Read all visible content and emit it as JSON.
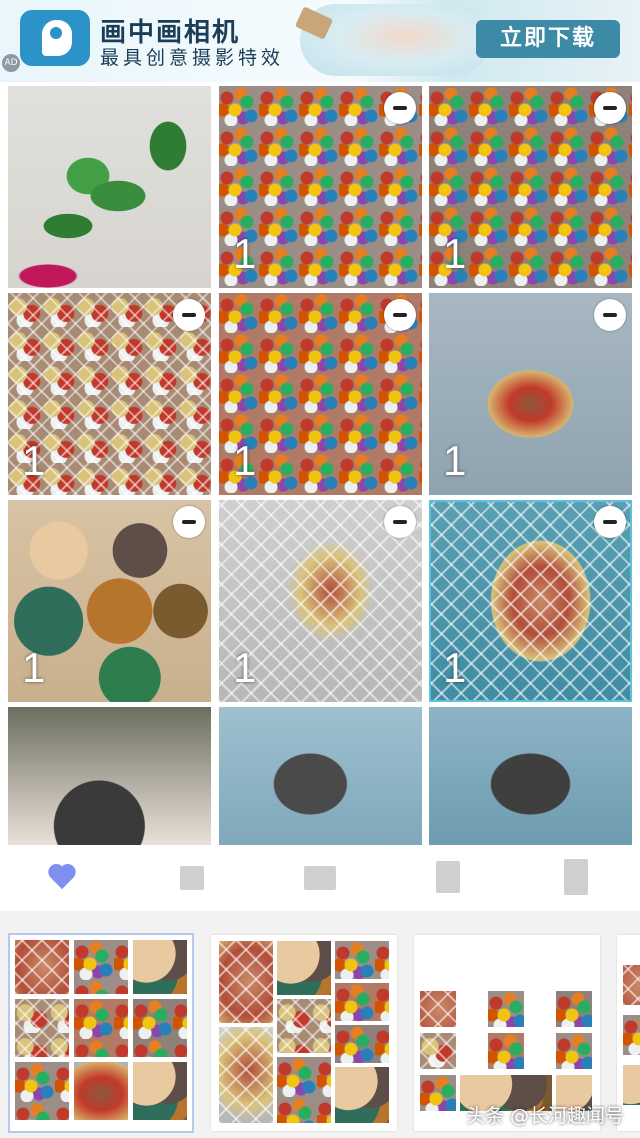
{
  "ad": {
    "title": "画中画相机",
    "subtitle": "最具创意摄影特效",
    "cta": "立即下载",
    "tag": "AD"
  },
  "grid": {
    "tiles": [
      {
        "count": "",
        "removable": false
      },
      {
        "count": "1",
        "removable": true
      },
      {
        "count": "1",
        "removable": true
      },
      {
        "count": "1",
        "removable": true
      },
      {
        "count": "1",
        "removable": true
      },
      {
        "count": "1",
        "removable": true
      },
      {
        "count": "1",
        "removable": true
      },
      {
        "count": "1",
        "removable": true
      },
      {
        "count": "1",
        "removable": true
      },
      {
        "count": "",
        "removable": false
      },
      {
        "count": "",
        "removable": false
      },
      {
        "count": "",
        "removable": false
      }
    ]
  },
  "toolbar": {
    "icons": [
      "heart-icon",
      "small-square-icon",
      "wide-rectangle-icon",
      "tall-rectangle-icon",
      "portrait-rectangle-icon"
    ],
    "accent": "#7e8ff0"
  },
  "footer": {
    "watermark": "头条 @长河趣闻号"
  }
}
